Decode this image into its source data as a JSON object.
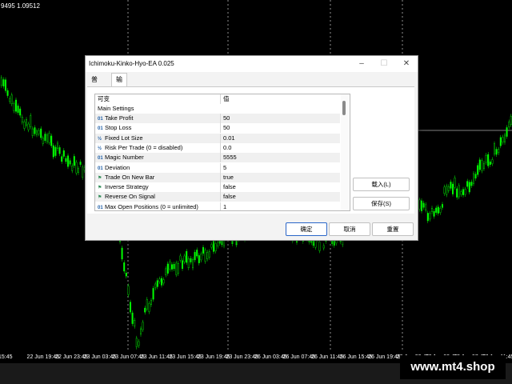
{
  "chart": {
    "ticker_text": "9495 1.09512",
    "time_labels": [
      "15:45",
      "22 Jun 19:45",
      "22 Jun 23:45",
      "23 Jun 03:45",
      "23 Jun 07:45",
      "23 Jun 11:45",
      "23 Jun 15:45",
      "23 Jun 19:45",
      "23 Jun 23:45",
      "26 Jun 03:45",
      "26 Jun 07:45",
      "26 Jun 11:45",
      "26 Jun 15:45",
      "26 Jun 19:45",
      "26 Jun 23:45",
      "27 Jun 03:45",
      "27 Jun 07:45",
      "27 Jun 11:45"
    ],
    "candle_color": "#00ff00"
  },
  "watermark": "www.mt4.shop",
  "dialog": {
    "title": "Ichimoku-Kinko-Hyo-EA 0.025",
    "minimize": "–",
    "maximize": "☐",
    "close": "✕",
    "tabs": [
      {
        "label": "普通",
        "active": false
      },
      {
        "label": "输入",
        "active": true
      }
    ],
    "table": {
      "headers": [
        "可变",
        "值"
      ],
      "section": "Main Settings",
      "rows": [
        {
          "icon": "01",
          "name": "Take Profit",
          "value": "50"
        },
        {
          "icon": "01",
          "name": "Stop Loss",
          "value": "50"
        },
        {
          "icon": "½",
          "name": "Fixed Lot Size",
          "value": "0.01"
        },
        {
          "icon": "½",
          "name": "Risk Per Trade (0 = disabled)",
          "value": "0.0"
        },
        {
          "icon": "01",
          "name": "Magic Number",
          "value": "5555"
        },
        {
          "icon": "01",
          "name": "Deviation",
          "value": "5"
        },
        {
          "icon": "⚑",
          "name": "Trade On New Bar",
          "value": "true"
        },
        {
          "icon": "⚑",
          "name": "Inverse Strategy",
          "value": "false"
        },
        {
          "icon": "⚑",
          "name": "Reverse On Signal",
          "value": "false"
        },
        {
          "icon": "01",
          "name": "Max Open Positions (0 = unlimited)",
          "value": "1"
        }
      ]
    },
    "load_button": "载入(L)",
    "save_button": "保存(S)",
    "ok_button": "确定",
    "cancel_button": "取消",
    "reset_button": "重置"
  }
}
